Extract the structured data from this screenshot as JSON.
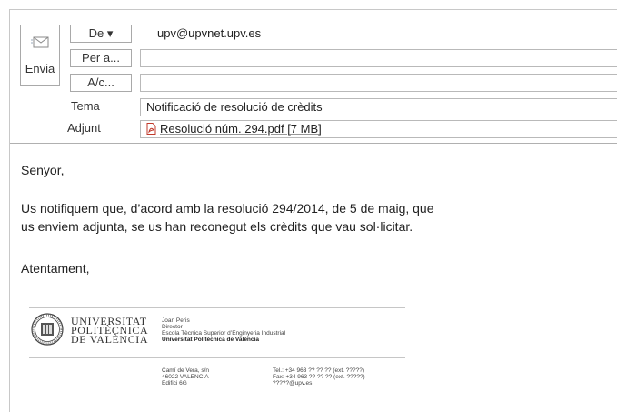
{
  "header": {
    "send_label": "Envia",
    "from_button": "De ▾",
    "from_value": "upv@upvnet.upv.es",
    "to_button": "Per a...",
    "to_value": "",
    "cc_button": "A/c...",
    "cc_value": "",
    "subject_label": "Tema",
    "subject_value": "Notificació de resolució de crèdits",
    "attachment_label": "Adjunt",
    "attachment_name": "Resolució núm. 294.pdf [7 MB]"
  },
  "body": {
    "greeting": "Senyor,",
    "paragraph_line1": "Us notifiquem que, d’acord amb la resolució 294/2014, de 5 de maig, que",
    "paragraph_line2": "us enviem adjunta, se us han reconegut els crèdits que vau sol·licitar.",
    "closing": "Atentament,"
  },
  "signature": {
    "university_line1": "UNIVERSITAT",
    "university_line2": "POLITÈCNICA",
    "university_line3": "DE VALÈNCIA",
    "name": "Joan Peris",
    "title": "Director",
    "school": "Escola Tècnica Superior d’Enginyeria Industrial",
    "university": "Universitat Politècnica de València",
    "address1": "Camí de Vera, s/n",
    "address2": "46022 VALENCIA",
    "address3": "Edifici 6G",
    "tel": "Tel.: +34 963 ?? ?? ?? (ext. ?????)",
    "fax": "Fax: +34 963 ?? ?? ?? (ext. ?????)",
    "email": "?????@upv.es"
  },
  "icons": {
    "send": "send-envelope-icon",
    "attachment": "pdf-file-icon",
    "logo": "university-seal-logo"
  },
  "colors": {
    "pdf_red": "#c0392b",
    "border": "#a9a9a9"
  }
}
